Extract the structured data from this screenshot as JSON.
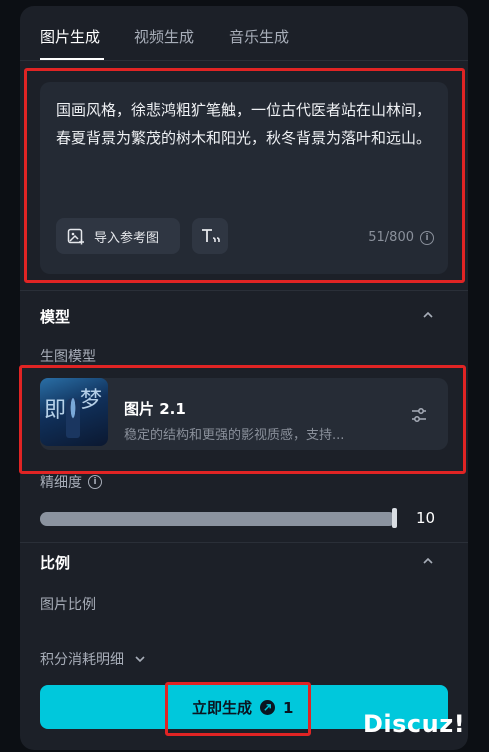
{
  "tabs": [
    {
      "label": "图片生成",
      "active": true
    },
    {
      "label": "视频生成",
      "active": false
    },
    {
      "label": "音乐生成",
      "active": false
    }
  ],
  "prompt": {
    "text": "国画风格，徐悲鸿粗犷笔触，一位古代医者站在山林间，春夏背景为繁茂的树木和阳光，秋冬背景为落叶和远山。",
    "import_label": "导入参考图",
    "char_count": "51/800"
  },
  "model_section": {
    "title": "模型",
    "sub_label": "生图模型",
    "model_name": "图片 2.1",
    "model_desc": "稳定的结构和更强的影视质感，支持...",
    "thumb_glyphs": [
      "即",
      "梦"
    ]
  },
  "detail": {
    "label": "精细度",
    "value": "10",
    "level_fraction": 1.0
  },
  "ratio_section": {
    "title": "比例",
    "sub_label": "图片比例"
  },
  "cost": {
    "label": "积分消耗明细"
  },
  "generate": {
    "label": "立即生成",
    "cost": "1"
  },
  "watermark": "Discuz!",
  "colors": {
    "accent": "#00c8dc",
    "highlight_box": "#e02424",
    "panel": "#1c2028"
  }
}
